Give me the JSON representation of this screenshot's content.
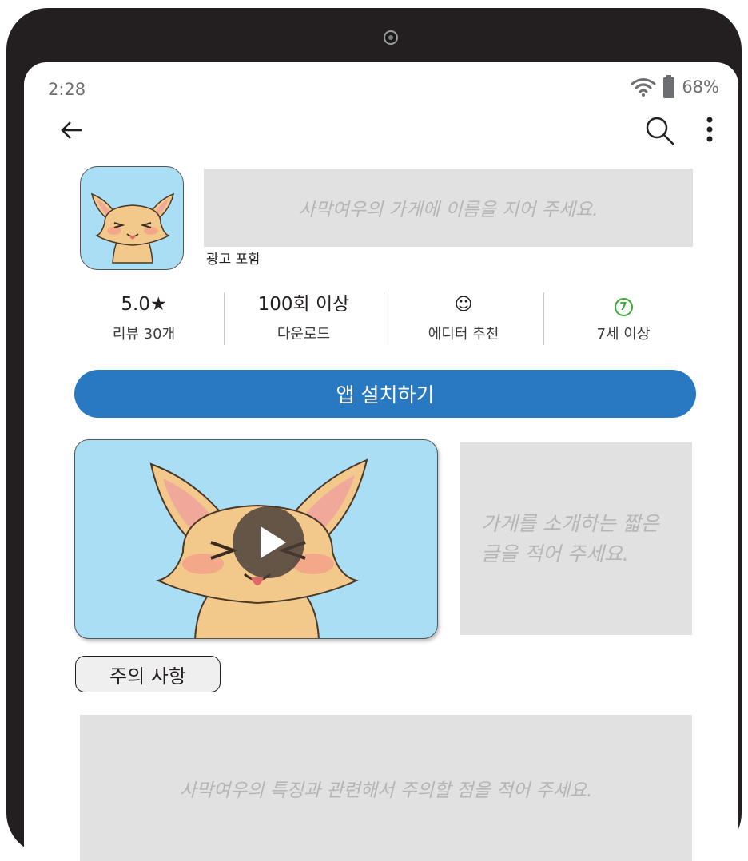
{
  "status_bar": {
    "time": "2:28",
    "battery_percent": "68%",
    "icons": [
      "wifi-icon",
      "battery-icon"
    ]
  },
  "toolbar": {
    "back_icon": "back-arrow-icon",
    "search_icon": "search-icon",
    "more_icon": "more-vertical-icon"
  },
  "app": {
    "name_placeholder": "사막여우의 가게에 이름을 지어 주세요.",
    "ads_label": "광고 포함"
  },
  "stats": {
    "rating": {
      "value": "5.0★",
      "label": "리뷰 30개"
    },
    "downloads": {
      "value": "100회 이상",
      "label": "다운로드"
    },
    "editor": {
      "icon": "smiley-icon",
      "value": "☺",
      "label": "에디터 추천"
    },
    "age": {
      "value": "7",
      "label": "7세 이상",
      "color": "#3aa935"
    }
  },
  "install_button": {
    "label": "앱 설치하기",
    "color": "#2879c1"
  },
  "media": {
    "play_icon": "play-icon"
  },
  "description": {
    "placeholder": "가게를 소개하는 짧은 글을 적어 주세요."
  },
  "caution": {
    "tab_label": "주의 사항",
    "placeholder": "사막여우의 특징과 관련해서 주의할 점을 적어 주세요."
  }
}
